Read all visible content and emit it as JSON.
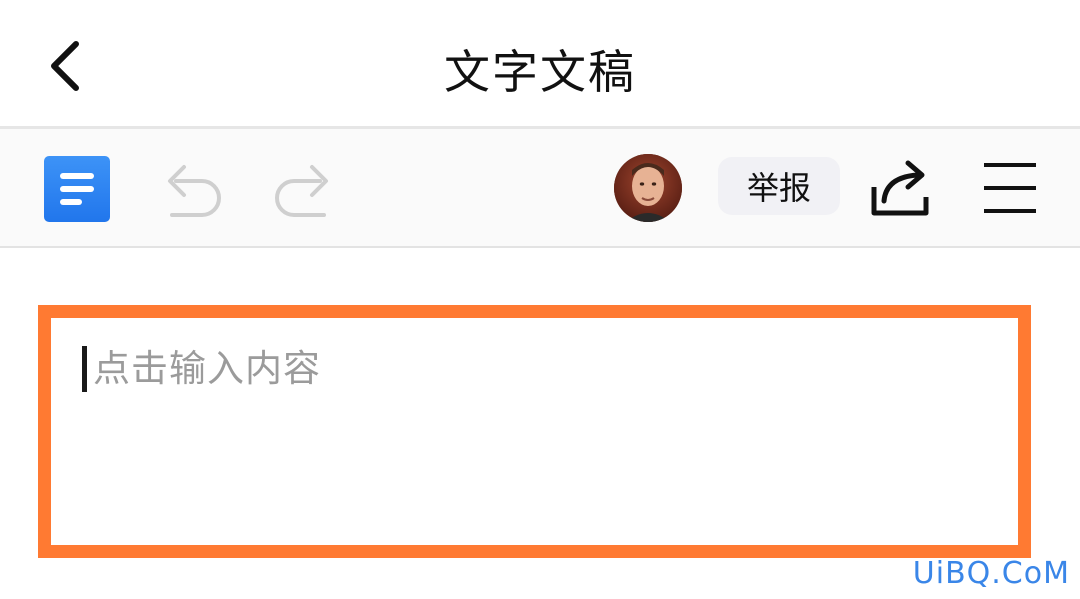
{
  "header": {
    "title": "文字文稿",
    "back_icon": "chevron-left-icon"
  },
  "toolbar": {
    "doc_icon": "document-icon",
    "undo_icon": "undo-icon",
    "redo_icon": "redo-icon",
    "avatar_icon": "user-avatar",
    "report_label": "举报",
    "share_icon": "share-icon",
    "menu_icon": "hamburger-menu-icon"
  },
  "editor": {
    "placeholder": "点击输入内容",
    "highlight_color": "#ff7a32"
  },
  "colors": {
    "accent": "#2f86f2",
    "highlight": "#ff7a32",
    "watermark": "#3a86e8"
  },
  "watermark": {
    "text": "UiBQ.CoM"
  }
}
